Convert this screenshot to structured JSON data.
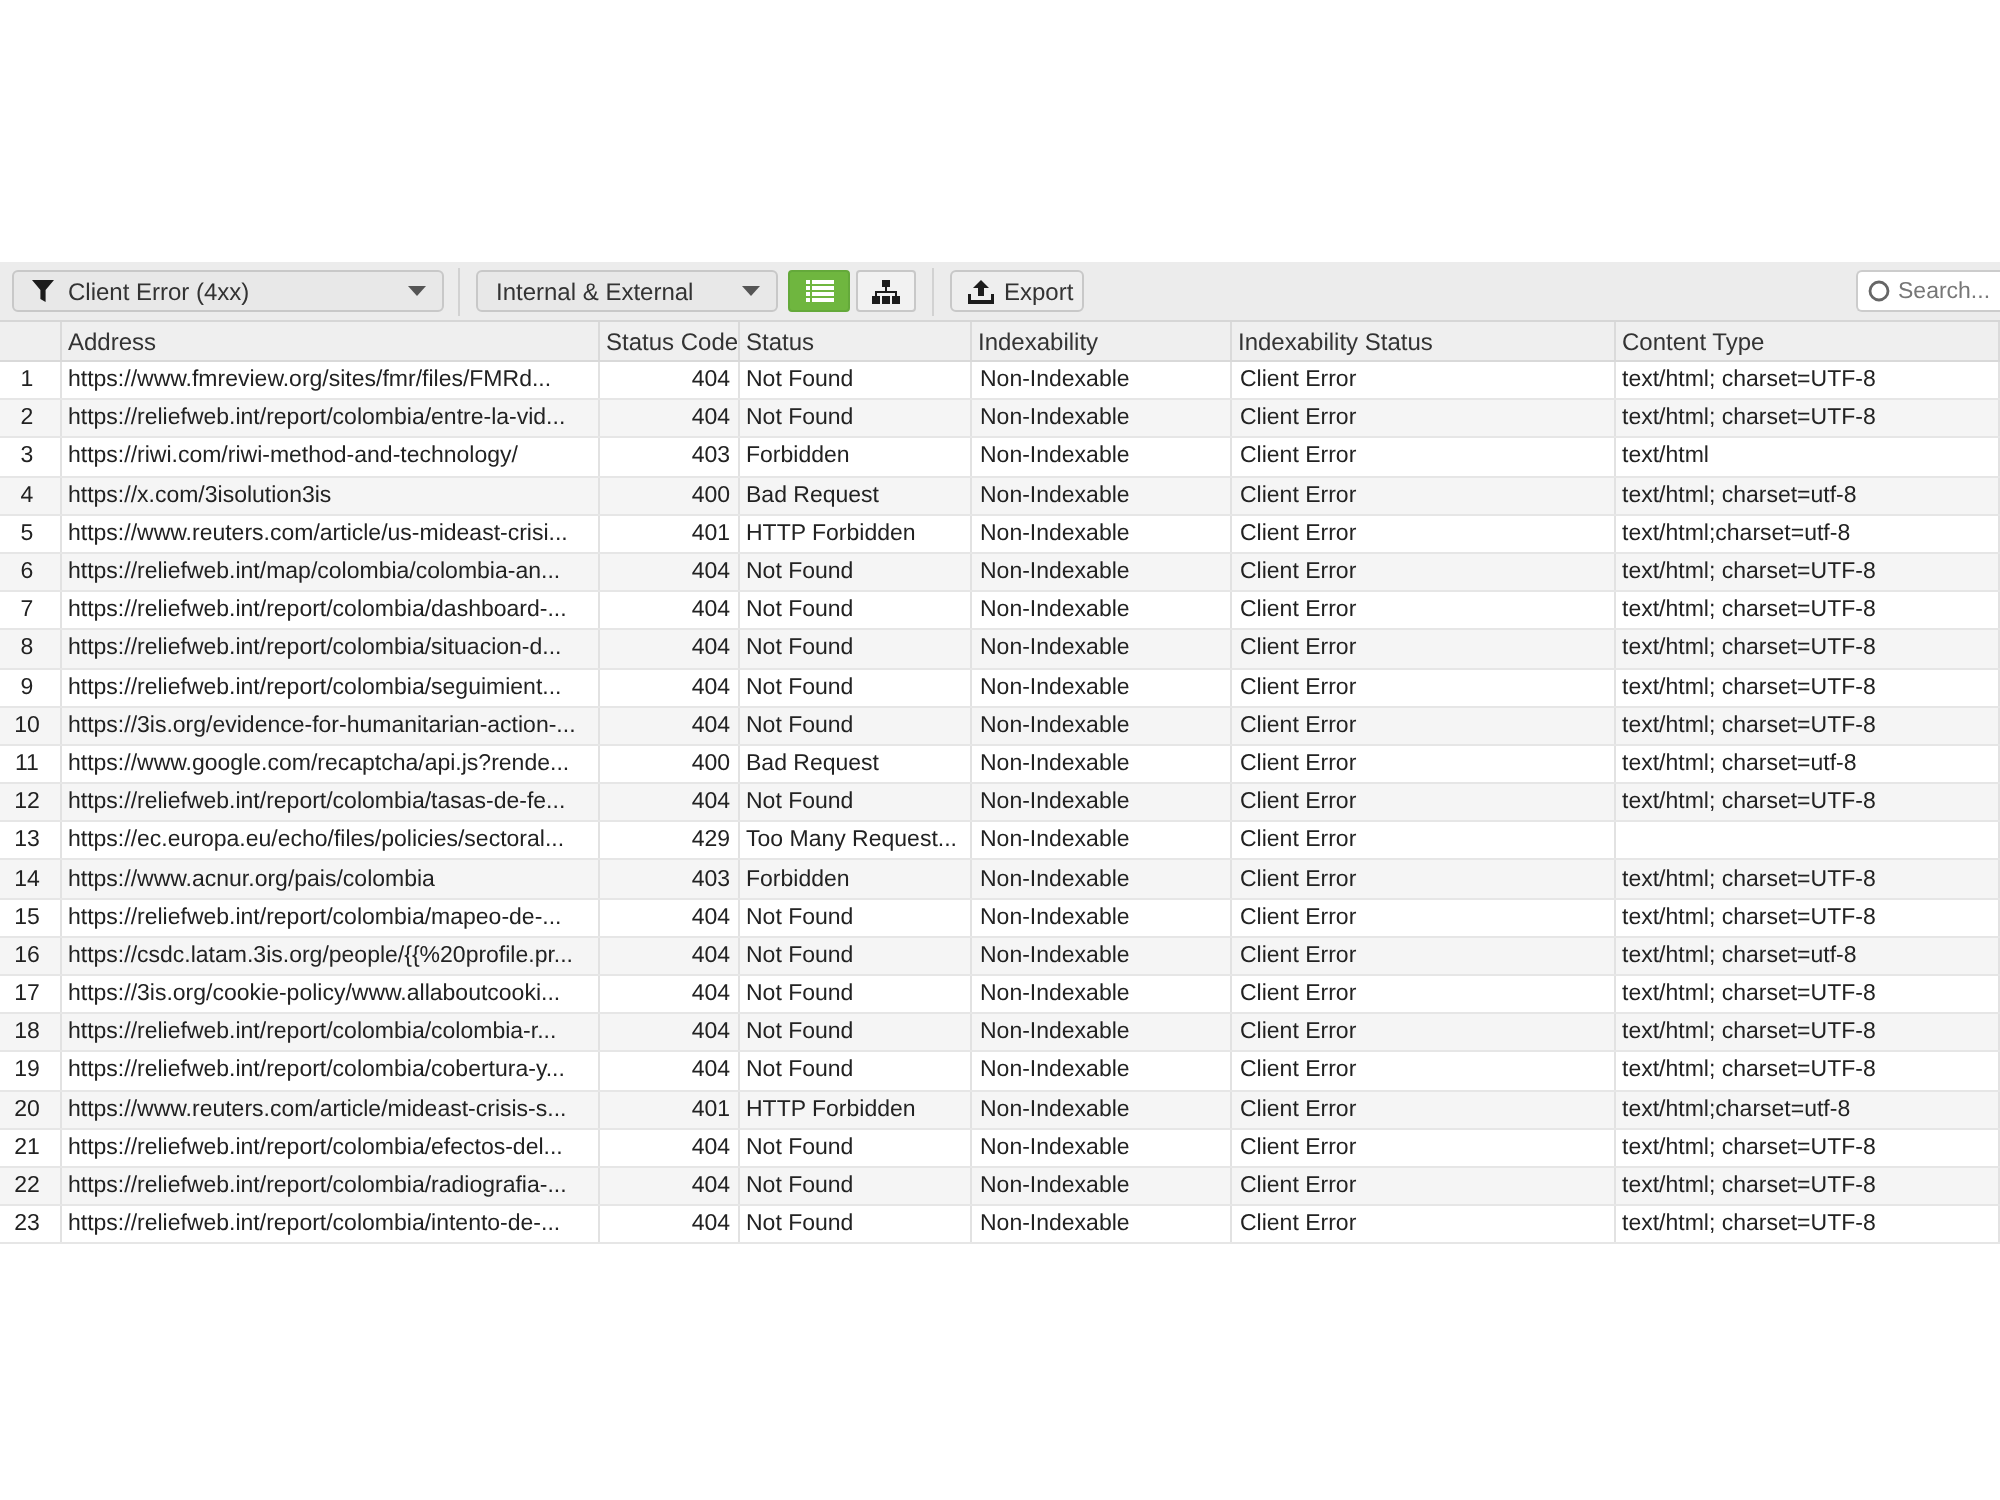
{
  "toolbar": {
    "filter": {
      "label": "Client Error (4xx)"
    },
    "scope": {
      "label": "Internal & External"
    },
    "view_buttons": [
      {
        "kind": "list",
        "selected": true
      },
      {
        "kind": "tree",
        "selected": false
      }
    ],
    "export": {
      "label": "Export"
    },
    "search": {
      "placeholder": "Search..."
    }
  },
  "table": {
    "columns": [
      "Address",
      "Status Code",
      "Status",
      "Indexability",
      "Indexability Status",
      "Content Type"
    ],
    "rows": [
      {
        "number": "1",
        "address": "https://www.fmreview.org/sites/fmr/files/FMRd...",
        "status_code": "404",
        "status": "Not Found",
        "indexability": "Non-Indexable",
        "indexability_status": "Client Error",
        "content_type": "text/html; charset=UTF-8"
      },
      {
        "number": "2",
        "address": "https://reliefweb.int/report/colombia/entre-la-vid...",
        "status_code": "404",
        "status": "Not Found",
        "indexability": "Non-Indexable",
        "indexability_status": "Client Error",
        "content_type": "text/html; charset=UTF-8"
      },
      {
        "number": "3",
        "address": "https://riwi.com/riwi-method-and-technology/",
        "status_code": "403",
        "status": "Forbidden",
        "indexability": "Non-Indexable",
        "indexability_status": "Client Error",
        "content_type": "text/html"
      },
      {
        "number": "4",
        "address": "https://x.com/3isolution3is",
        "status_code": "400",
        "status": "Bad Request",
        "indexability": "Non-Indexable",
        "indexability_status": "Client Error",
        "content_type": "text/html; charset=utf-8"
      },
      {
        "number": "5",
        "address": "https://www.reuters.com/article/us-mideast-crisi...",
        "status_code": "401",
        "status": "HTTP Forbidden",
        "indexability": "Non-Indexable",
        "indexability_status": "Client Error",
        "content_type": "text/html;charset=utf-8"
      },
      {
        "number": "6",
        "address": "https://reliefweb.int/map/colombia/colombia-an...",
        "status_code": "404",
        "status": "Not Found",
        "indexability": "Non-Indexable",
        "indexability_status": "Client Error",
        "content_type": "text/html; charset=UTF-8"
      },
      {
        "number": "7",
        "address": "https://reliefweb.int/report/colombia/dashboard-...",
        "status_code": "404",
        "status": "Not Found",
        "indexability": "Non-Indexable",
        "indexability_status": "Client Error",
        "content_type": "text/html; charset=UTF-8"
      },
      {
        "number": "8",
        "address": "https://reliefweb.int/report/colombia/situacion-d...",
        "status_code": "404",
        "status": "Not Found",
        "indexability": "Non-Indexable",
        "indexability_status": "Client Error",
        "content_type": "text/html; charset=UTF-8"
      },
      {
        "number": "9",
        "address": "https://reliefweb.int/report/colombia/seguimient...",
        "status_code": "404",
        "status": "Not Found",
        "indexability": "Non-Indexable",
        "indexability_status": "Client Error",
        "content_type": "text/html; charset=UTF-8"
      },
      {
        "number": "10",
        "address": "https://3is.org/evidence-for-humanitarian-action-...",
        "status_code": "404",
        "status": "Not Found",
        "indexability": "Non-Indexable",
        "indexability_status": "Client Error",
        "content_type": "text/html; charset=UTF-8"
      },
      {
        "number": "11",
        "address": "https://www.google.com/recaptcha/api.js?rende...",
        "status_code": "400",
        "status": "Bad Request",
        "indexability": "Non-Indexable",
        "indexability_status": "Client Error",
        "content_type": "text/html; charset=utf-8"
      },
      {
        "number": "12",
        "address": "https://reliefweb.int/report/colombia/tasas-de-fe...",
        "status_code": "404",
        "status": "Not Found",
        "indexability": "Non-Indexable",
        "indexability_status": "Client Error",
        "content_type": "text/html; charset=UTF-8"
      },
      {
        "number": "13",
        "address": "https://ec.europa.eu/echo/files/policies/sectoral...",
        "status_code": "429",
        "status": "Too Many Request...",
        "indexability": "Non-Indexable",
        "indexability_status": "Client Error"
      },
      {
        "number": "14",
        "address": "https://www.acnur.org/pais/colombia",
        "status_code": "403",
        "status": "Forbidden",
        "indexability": "Non-Indexable",
        "indexability_status": "Client Error",
        "content_type": "text/html; charset=UTF-8"
      },
      {
        "number": "15",
        "address": "https://reliefweb.int/report/colombia/mapeo-de-...",
        "status_code": "404",
        "status": "Not Found",
        "indexability": "Non-Indexable",
        "indexability_status": "Client Error",
        "content_type": "text/html; charset=UTF-8"
      },
      {
        "number": "16",
        "address": "https://csdc.latam.3is.org/people/{{%20profile.pr...",
        "status_code": "404",
        "status": "Not Found",
        "indexability": "Non-Indexable",
        "indexability_status": "Client Error",
        "content_type": "text/html; charset=utf-8"
      },
      {
        "number": "17",
        "address": "https://3is.org/cookie-policy/www.allaboutcooki...",
        "status_code": "404",
        "status": "Not Found",
        "indexability": "Non-Indexable",
        "indexability_status": "Client Error",
        "content_type": "text/html; charset=UTF-8"
      },
      {
        "number": "18",
        "address": "https://reliefweb.int/report/colombia/colombia-r...",
        "status_code": "404",
        "status": "Not Found",
        "indexability": "Non-Indexable",
        "indexability_status": "Client Error",
        "content_type": "text/html; charset=UTF-8"
      },
      {
        "number": "19",
        "address": "https://reliefweb.int/report/colombia/cobertura-y...",
        "status_code": "404",
        "status": "Not Found",
        "indexability": "Non-Indexable",
        "indexability_status": "Client Error",
        "content_type": "text/html; charset=UTF-8"
      },
      {
        "number": "20",
        "address": "https://www.reuters.com/article/mideast-crisis-s...",
        "status_code": "401",
        "status": "HTTP Forbidden",
        "indexability": "Non-Indexable",
        "indexability_status": "Client Error",
        "content_type": "text/html;charset=utf-8"
      },
      {
        "number": "21",
        "address": "https://reliefweb.int/report/colombia/efectos-del...",
        "status_code": "404",
        "status": "Not Found",
        "indexability": "Non-Indexable",
        "indexability_status": "Client Error",
        "content_type": "text/html; charset=UTF-8"
      },
      {
        "number": "22",
        "address": "https://reliefweb.int/report/colombia/radiografia-...",
        "status_code": "404",
        "status": "Not Found",
        "indexability": "Non-Indexable",
        "indexability_status": "Client Error",
        "content_type": "text/html; charset=UTF-8"
      },
      {
        "number": "23",
        "address": "https://reliefweb.int/report/colombia/intento-de-...",
        "status_code": "404",
        "status": "Not Found",
        "indexability": "Non-Indexable",
        "indexability_status": "Client Error",
        "content_type": "text/html; charset=UTF-8"
      }
    ]
  }
}
